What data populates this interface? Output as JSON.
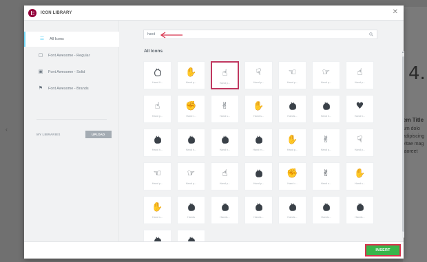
{
  "background": {
    "big_number": "4.",
    "lines": [
      "em Title",
      "um dolo",
      "adipiscing",
      "vitae mag",
      "laoreet"
    ]
  },
  "modal": {
    "title": "ICON LIBRARY",
    "close_icon": "close-icon"
  },
  "sidebar": {
    "items": [
      {
        "label": "All Icons",
        "icon": "list-icon",
        "active": true
      },
      {
        "label": "Font Awesome - Regular",
        "icon": "square-icon",
        "active": false
      },
      {
        "label": "Font Awesome - Solid",
        "icon": "square-filled-icon",
        "active": false
      },
      {
        "label": "Font Awesome - Brands",
        "icon": "flag-icon",
        "active": false
      }
    ],
    "my_libraries_label": "MY LIBRARIES",
    "upload_label": "UPLOAD"
  },
  "search": {
    "value": "hand",
    "icon": "search-icon"
  },
  "section_title": "All Icons",
  "icons": [
    {
      "label": "Hand li...",
      "icon": "hand-lizard"
    },
    {
      "label": "Hand p...",
      "icon": "hand-paper"
    },
    {
      "label": "Hand p...",
      "icon": "hand-pointer",
      "selected": true
    },
    {
      "label": "Hand p...",
      "icon": "hand-point-down"
    },
    {
      "label": "Hand p...",
      "icon": "hand-point-left"
    },
    {
      "label": "Hand p...",
      "icon": "hand-point-right"
    },
    {
      "label": "Hand p...",
      "icon": "hand-point-up"
    },
    {
      "label": "Hand p...",
      "icon": "hand-pointer-o"
    },
    {
      "label": "Hand r...",
      "icon": "hand-rock"
    },
    {
      "label": "Hand s...",
      "icon": "hand-scissors"
    },
    {
      "label": "Hand s...",
      "icon": "hand-spock"
    },
    {
      "label": "Hands...",
      "icon": "handshake"
    },
    {
      "label": "Hand h...",
      "icon": "hand-holding"
    },
    {
      "label": "Hand h...",
      "icon": "hand-holding-heart"
    },
    {
      "label": "Hand h...",
      "icon": "hand-holding-medical"
    },
    {
      "label": "Hand h...",
      "icon": "hand-holding-usd"
    },
    {
      "label": "Hand h...",
      "icon": "hand-lizard-solid"
    },
    {
      "label": "Hand m...",
      "icon": "hand-middle-finger"
    },
    {
      "label": "Hand p...",
      "icon": "hand-paper-solid"
    },
    {
      "label": "Hand p...",
      "icon": "hand-peace"
    },
    {
      "label": "Hand p...",
      "icon": "hand-point-down-solid"
    },
    {
      "label": "Hand p...",
      "icon": "hand-point-left-solid"
    },
    {
      "label": "Hand p...",
      "icon": "hand-point-right-solid"
    },
    {
      "label": "Hand p...",
      "icon": "hand-point-up-solid"
    },
    {
      "label": "Hand p...",
      "icon": "hand-pointer-solid"
    },
    {
      "label": "Hand r...",
      "icon": "hand-rock-solid"
    },
    {
      "label": "Hand s...",
      "icon": "hand-scissors-solid"
    },
    {
      "label": "Hand s...",
      "icon": "hand-sparkles"
    },
    {
      "label": "Hand s...",
      "icon": "hand-spock-solid"
    },
    {
      "label": "Hands",
      "icon": "hands"
    },
    {
      "label": "Hands...",
      "icon": "hands-helping"
    },
    {
      "label": "Hands...",
      "icon": "hands-wash"
    },
    {
      "label": "Hands...",
      "icon": "handshake-solid"
    },
    {
      "label": "Hands...",
      "icon": "handshake-alt-slash"
    },
    {
      "label": "Hands...",
      "icon": "handshake-slash"
    },
    {
      "label": "Hands...",
      "icon": "hand-praying"
    },
    {
      "label": "Hands...",
      "icon": "hands-clapping"
    }
  ],
  "footer": {
    "insert_label": "INSERT"
  }
}
